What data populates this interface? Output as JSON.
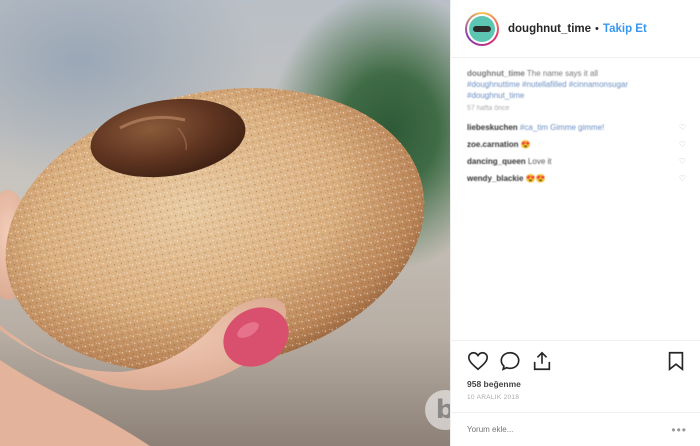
{
  "post": {
    "username": "doughnut_time",
    "separator": "•",
    "follow_label": "Takip Et",
    "caption_user": "doughnut_time",
    "caption_text": "The name says it all",
    "caption_hashtags": "#doughnuttime #nutellafilled #cinnamonsugar #doughnut_time",
    "caption_meta": "57 hafta önce",
    "comments": [
      {
        "user": "liebeskuchen",
        "text": "#ca_tim Gimme gimme!",
        "tag": ""
      },
      {
        "user": "zoe.carnation",
        "text": "😍",
        "tag": ""
      },
      {
        "user": "dancing_queen",
        "text": "Love it",
        "tag": ""
      },
      {
        "user": "wendy_blackie",
        "text": "😍😍",
        "tag": ""
      }
    ],
    "likes": "958 beğenme",
    "timestamp": "10 ARALIK 2018",
    "add_comment_placeholder": "Yorum ekle...",
    "more_label": "•••",
    "watermark": "b"
  },
  "icons": {
    "like": "heart-icon",
    "comment": "comment-bubble-icon",
    "share": "share-icon",
    "save": "bookmark-icon",
    "comment_like": "small-heart-icon"
  },
  "colors": {
    "link": "#3897f0",
    "text": "#262626",
    "muted": "#999999",
    "avatar_bg": "#5cc6b2"
  }
}
